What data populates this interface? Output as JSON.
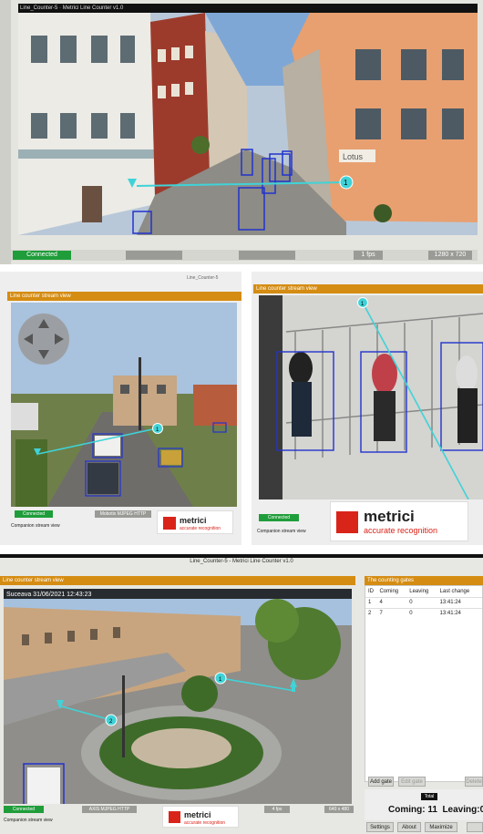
{
  "panel1": {
    "title_bar": "Line_Counter-5 · Metrici Line Counter v1.0",
    "status": "Connected",
    "fps": "1 fps",
    "resolution": "1280 x 720",
    "gate_number": "1",
    "store_sign": "Lotus"
  },
  "panel2": {
    "header": "Line counter stream view",
    "window_title": "Line_Counter-5",
    "status": "Connected",
    "stream_type": "Mobotix MJPEG HTTP",
    "footer": "Companion stream view",
    "gate_number": "1"
  },
  "panel3": {
    "header": "Line counter stream view",
    "status": "Connected",
    "footer": "Companion stream view",
    "gate_number": "1"
  },
  "panel4": {
    "window_title": "Line_Counter-5 - Metrici Line Counter v1.0",
    "header": "Line counter stream view",
    "timestamp": "Suceava 31/06/2021 12:43:23",
    "status": "Connected",
    "stream_type": "AXIS MJPEG HTTP",
    "fps": "4 fps",
    "resolution": "640 x 480",
    "footer": "Companion stream view",
    "gate_labels": [
      "1",
      "2"
    ]
  },
  "logo": {
    "word": "metrici",
    "sub": "accurate recognition"
  },
  "gates_table": {
    "title": "The counting gates",
    "columns": [
      "ID",
      "Coming",
      "Leaving",
      "Last change"
    ],
    "rows": [
      [
        "1",
        "4",
        "0",
        "13:41:24"
      ],
      [
        "2",
        "7",
        "0",
        "13:41:24"
      ]
    ],
    "buttons": {
      "add": "Add gate",
      "edit": "Edit gate",
      "delete": "Delete"
    },
    "total_label": "Total",
    "total_text": "Coming: 11  Leaving:0"
  },
  "bottom_buttons": [
    "Settings",
    "About",
    "Maximize"
  ],
  "colors": {
    "accent": "#d58c12",
    "connected": "#1f9d3a",
    "brand": "#d9241a",
    "box": "#2233cc",
    "line": "#3fd3d8"
  }
}
